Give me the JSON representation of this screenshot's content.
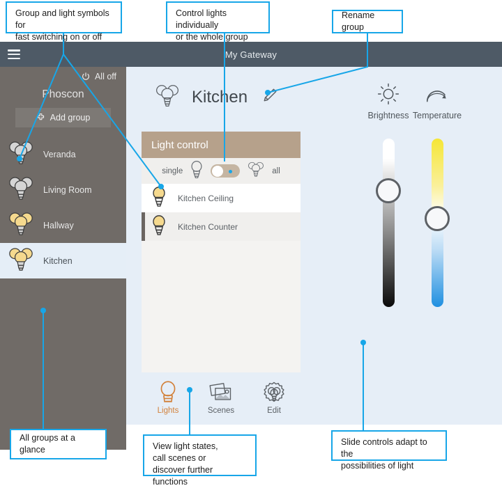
{
  "window": {
    "gateway_title": "My Gateway",
    "menu_icon": "hamburger-menu-icon"
  },
  "sidebar": {
    "all_off_label": "All off",
    "all_off_icon": "power-icon",
    "brand": "Phoscon",
    "add_group_label": "Add group",
    "add_group_icon": "plus-icon",
    "groups": [
      {
        "label": "Veranda",
        "icon": "group-bulbs-off-icon",
        "state": "off",
        "selected": false
      },
      {
        "label": "Living Room",
        "icon": "group-bulbs-off-icon",
        "state": "off",
        "selected": false
      },
      {
        "label": "Hallway",
        "icon": "group-bulbs-on-icon",
        "state": "on",
        "selected": false
      },
      {
        "label": "Kitchen",
        "icon": "group-bulbs-on-icon",
        "state": "on",
        "selected": true
      }
    ]
  },
  "main": {
    "group_name": "Kitchen",
    "group_icon": "group-bulbs-icon",
    "rename_icon": "pencil-icon",
    "card": {
      "title": "Light control",
      "single_label": "single",
      "single_icon": "single-bulb-icon",
      "all_label": "all",
      "all_icon": "group-bulbs-icon",
      "toggle_position": "all",
      "lights": [
        {
          "label": "Kitchen Ceiling",
          "icon": "bulb-on-icon",
          "selected": false
        },
        {
          "label": "Kitchen Counter",
          "icon": "bulb-on-icon",
          "selected": true
        }
      ]
    },
    "sliders": [
      {
        "name": "Brightness",
        "icon": "sun-icon",
        "value_pct": 28,
        "gradient_from": "#ffffff",
        "gradient_to": "#000000"
      },
      {
        "name": "Temperature",
        "icon": "temperature-arc-icon",
        "value_pct": 45,
        "gradient_from": "#f5e636",
        "gradient_to": "#1f8fe0"
      }
    ],
    "bottom_nav": [
      {
        "label": "Lights",
        "icon": "bulb-outline-icon",
        "active": true
      },
      {
        "label": "Scenes",
        "icon": "photos-icon",
        "active": false
      },
      {
        "label": "Edit",
        "icon": "gear-bulb-icon",
        "active": false
      }
    ]
  },
  "annotations": {
    "accent_color": "#17a6e8",
    "items": [
      {
        "id": "groups-and-symbols",
        "text": "Group and light symbols for\nfast switching on or off"
      },
      {
        "id": "control-lights",
        "text": "Control lights individually\nor the whole group"
      },
      {
        "id": "rename-group",
        "text": "Rename group"
      },
      {
        "id": "all-groups",
        "text": "All groups at a glance"
      },
      {
        "id": "view-light-states",
        "text": "View light states,\ncall scenes or\ndiscover further functions"
      },
      {
        "id": "slide-controls",
        "text": "Slide controls adapt to the\npossibilities of light"
      }
    ]
  }
}
